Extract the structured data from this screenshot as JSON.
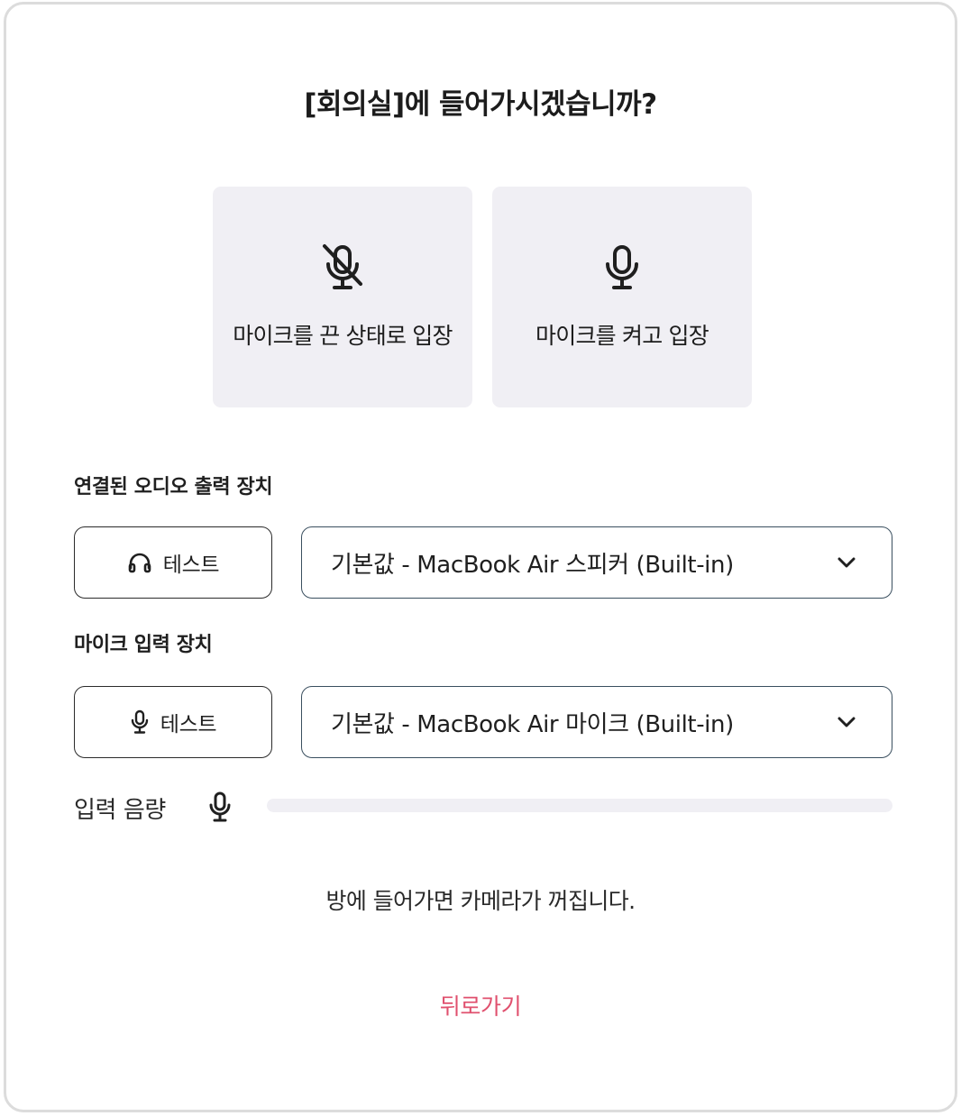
{
  "dialog": {
    "title": "[회의실]에 들어가시겠습니까?",
    "options": {
      "muted": {
        "label": "마이크를 끈 상태로 입장",
        "icon": "mic-off-icon"
      },
      "unmuted": {
        "label": "마이크를 켜고 입장",
        "icon": "mic-icon"
      }
    },
    "audio_output": {
      "label": "연결된 오디오 출력 장치",
      "test_label": "테스트",
      "test_icon": "headphones-icon",
      "selected": "기본값 - MacBook Air 스피커 (Built-in)"
    },
    "mic_input": {
      "label": "마이크 입력 장치",
      "test_label": "테스트",
      "test_icon": "mic-icon",
      "selected": "기본값 - MacBook Air 마이크 (Built-in)"
    },
    "input_volume": {
      "label": "입력 음량",
      "level_percent": 0
    },
    "notice": "방에 들어가면 카메라가 꺼집니다.",
    "back_label": "뒤로가기"
  },
  "colors": {
    "card_bg": "#f0eff4",
    "accent_back": "#e0506e",
    "select_border": "#3a4f5f",
    "dialog_border": "#dcdcdc"
  }
}
